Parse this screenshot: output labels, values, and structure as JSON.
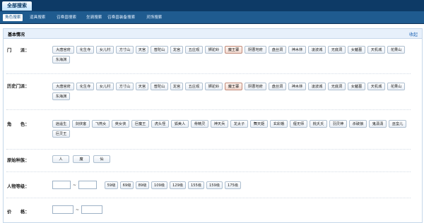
{
  "app": {
    "title": "全部搜索"
  },
  "nav": {
    "items": [
      "角色搜索",
      "道具搜索",
      "召唤兽搜索",
      "坐骑搜索",
      "召唤兽装备搜索",
      "灵饰搜索"
    ]
  },
  "section": {
    "title": "基本情况",
    "link": "收起"
  },
  "rows": {
    "menpai": {
      "label": "门　　派：",
      "options": [
        "大唐官府",
        "化生寺",
        "女儿村",
        "方寸山",
        "天宫",
        "普陀山",
        "龙宫",
        "五庄观",
        "狮驼岭",
        "魔王寨",
        "阴曹地府",
        "盘丝洞",
        "神木林",
        "凌波城",
        "无底洞",
        "女魃墓",
        "天机城",
        "花果山",
        "东海渊"
      ]
    },
    "history": {
      "label": "历史门派：",
      "options": [
        "大唐官府",
        "化生寺",
        "女儿村",
        "方寸山",
        "天宫",
        "普陀山",
        "龙宫",
        "五庄观",
        "狮驼岭",
        "魔王寨",
        "阴曹地府",
        "盘丝洞",
        "神木林",
        "凌波城",
        "无底洞",
        "女魃墓",
        "天机城",
        "花果山",
        "东海渊"
      ]
    },
    "role": {
      "label": "角　　色：",
      "options": [
        "逍遥生",
        "剑侠客",
        "飞燕女",
        "英女侠",
        "巨魔王",
        "虎头怪",
        "狐美人",
        "骨精灵",
        "神天兵",
        "龙太子",
        "舞天姬",
        "玄彩娥",
        "偃无师",
        "桃夭夭",
        "羽灵神",
        "杀破狼",
        "鬼潇潇",
        "巫蛮儿",
        "巨灵王"
      ]
    },
    "race": {
      "label": "原始种族：",
      "options": [
        "人",
        "魔",
        "仙"
      ]
    },
    "level": {
      "label": "人物等级：",
      "tilde": "~",
      "options": [
        "59级",
        "69级",
        "89级",
        "109级",
        "129级",
        "155级",
        "159级",
        "175级"
      ]
    },
    "price": {
      "label": "价　　格：",
      "tilde": "~"
    }
  },
  "colors": {
    "topbar": "#0d3a66",
    "navbar": "#1f5b8f",
    "section_header": "#e7f0fb"
  }
}
